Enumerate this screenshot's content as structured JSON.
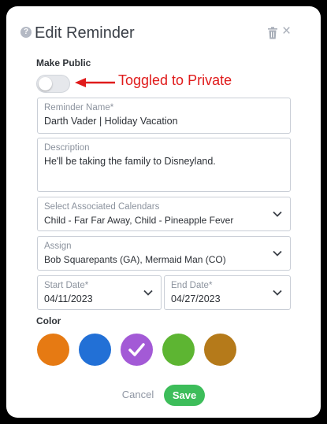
{
  "dialog": {
    "title": "Edit Reminder",
    "help_symbol": "?",
    "close_symbol": "×"
  },
  "make_public": {
    "label": "Make Public",
    "enabled": false
  },
  "annotation": {
    "text": "Toggled to Private",
    "color": "#e01b1b"
  },
  "fields": {
    "reminder_name": {
      "label": "Reminder Name*",
      "value": "Darth Vader | Holiday Vacation"
    },
    "description": {
      "label": "Description",
      "value": "He'll be taking the family to Disneyland."
    },
    "calendars": {
      "label": "Select Associated Calendars",
      "value": "Child - Far Far Away, Child - Pineapple Fever"
    },
    "assign": {
      "label": "Assign",
      "value": "Bob Squarepants (GA), Mermaid Man (CO)"
    },
    "start_date": {
      "label": "Start Date*",
      "value": "04/11/2023"
    },
    "end_date": {
      "label": "End Date*",
      "value": "04/27/2023"
    }
  },
  "color": {
    "label": "Color",
    "swatches": [
      "#e67a13",
      "#2270d6",
      "#a35ad6",
      "#5db532",
      "#b57a1a"
    ],
    "selected_index": 2
  },
  "actions": {
    "cancel_label": "Cancel",
    "save_label": "Save"
  },
  "icons": {
    "help": "help-icon",
    "delete": "trash-icon",
    "close": "close-icon",
    "dropdown": "chevron-down-icon",
    "selected": "check-icon"
  }
}
